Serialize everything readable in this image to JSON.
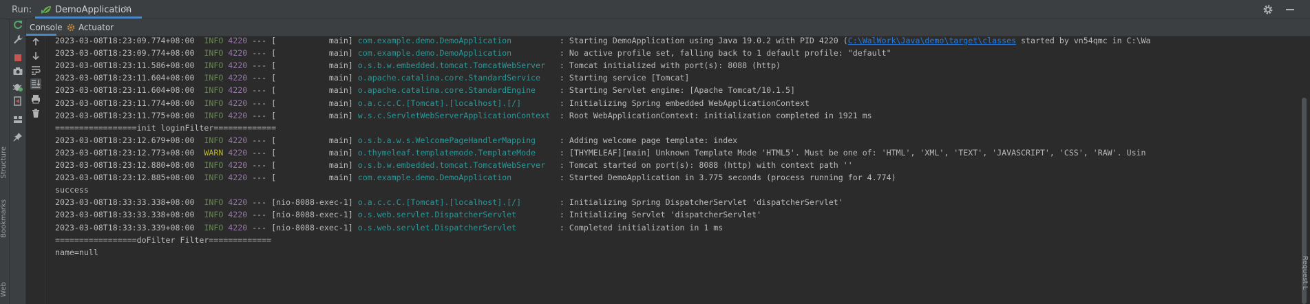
{
  "run_bar": {
    "label": "Run:",
    "tab_label": "DemoApplication",
    "tab_icon": "spring-boot-run-icon",
    "right_icons": [
      "gear-icon",
      "minimize-icon"
    ]
  },
  "sub_tabs": [
    {
      "label": "Console",
      "active": true
    },
    {
      "label": "Actuator",
      "active": false
    }
  ],
  "left_strip_labels": [
    "Structure",
    "Bookmarks",
    "Web"
  ],
  "right_strip_label": "Request L",
  "run_toolbar": [
    "rerun-icon",
    "wrench-icon",
    "stop-icon",
    "camera-icon",
    "debug-icon",
    "exit-icon",
    "layout-icon",
    "pin-icon"
  ],
  "console_toolbar": [
    "arrow-up-icon",
    "arrow-down-icon",
    "soft-wrap-icon",
    "scroll-to-end-icon",
    "print-icon",
    "trash-icon"
  ],
  "colors": {
    "info": "#6a8759",
    "warn": "#bbb529",
    "pid": "#9876aa",
    "logger": "#299999",
    "link": "#287bde",
    "accent": "#4a88c7"
  },
  "log_lines": [
    {
      "ts": "2023-03-08T18:23:09.774+08:00",
      "level": "INFO",
      "pid": "4220",
      "thread": "--- [           main]",
      "logger": "com.example.demo.DemoApplication",
      "msg_before": "Starting DemoApplication using Java 19.0.2 with PID 4220 (",
      "link": "C:\\WalWork\\Java\\demo\\target\\classes",
      "msg_after": " started by vn54qmc in C:\\Wa"
    },
    {
      "ts": "2023-03-08T18:23:09.774+08:00",
      "level": "INFO",
      "pid": "4220",
      "thread": "--- [           main]",
      "logger": "com.example.demo.DemoApplication",
      "msg_before": "No active profile set, falling back to 1 default profile: \"default\"",
      "link": "",
      "msg_after": ""
    },
    {
      "ts": "2023-03-08T18:23:11.586+08:00",
      "level": "INFO",
      "pid": "4220",
      "thread": "--- [           main]",
      "logger": "o.s.b.w.embedded.tomcat.TomcatWebServer",
      "msg_before": "Tomcat initialized with port(s): 8088 (http)",
      "link": "",
      "msg_after": ""
    },
    {
      "ts": "2023-03-08T18:23:11.604+08:00",
      "level": "INFO",
      "pid": "4220",
      "thread": "--- [           main]",
      "logger": "o.apache.catalina.core.StandardService",
      "msg_before": "Starting service [Tomcat]",
      "link": "",
      "msg_after": ""
    },
    {
      "ts": "2023-03-08T18:23:11.604+08:00",
      "level": "INFO",
      "pid": "4220",
      "thread": "--- [           main]",
      "logger": "o.apache.catalina.core.StandardEngine",
      "msg_before": "Starting Servlet engine: [Apache Tomcat/10.1.5]",
      "link": "",
      "msg_after": ""
    },
    {
      "ts": "2023-03-08T18:23:11.774+08:00",
      "level": "INFO",
      "pid": "4220",
      "thread": "--- [           main]",
      "logger": "o.a.c.c.C.[Tomcat].[localhost].[/]",
      "msg_before": "Initializing Spring embedded WebApplicationContext",
      "link": "",
      "msg_after": ""
    },
    {
      "ts": "2023-03-08T18:23:11.775+08:00",
      "level": "INFO",
      "pid": "4220",
      "thread": "--- [           main]",
      "logger": "w.s.c.ServletWebServerApplicationContext",
      "msg_before": "Root WebApplicationContext: initialization completed in 1921 ms",
      "link": "",
      "msg_after": ""
    },
    {
      "plain": "=================init loginFilter============="
    },
    {
      "ts": "2023-03-08T18:23:12.679+08:00",
      "level": "INFO",
      "pid": "4220",
      "thread": "--- [           main]",
      "logger": "o.s.b.a.w.s.WelcomePageHandlerMapping",
      "msg_before": "Adding welcome page template: index",
      "link": "",
      "msg_after": ""
    },
    {
      "ts": "2023-03-08T18:23:12.773+08:00",
      "level": "WARN",
      "pid": "4220",
      "thread": "--- [           main]",
      "logger": "o.thymeleaf.templatemode.TemplateMode",
      "msg_before": "[THYMELEAF][main] Unknown Template Mode 'HTML5'. Must be one of: 'HTML', 'XML', 'TEXT', 'JAVASCRIPT', 'CSS', 'RAW'. Usin",
      "link": "",
      "msg_after": ""
    },
    {
      "ts": "2023-03-08T18:23:12.880+08:00",
      "level": "INFO",
      "pid": "4220",
      "thread": "--- [           main]",
      "logger": "o.s.b.w.embedded.tomcat.TomcatWebServer",
      "msg_before": "Tomcat started on port(s): 8088 (http) with context path ''",
      "link": "",
      "msg_after": ""
    },
    {
      "ts": "2023-03-08T18:23:12.885+08:00",
      "level": "INFO",
      "pid": "4220",
      "thread": "--- [           main]",
      "logger": "com.example.demo.DemoApplication",
      "msg_before": "Started DemoApplication in 3.775 seconds (process running for 4.774)",
      "link": "",
      "msg_after": ""
    },
    {
      "plain": "success"
    },
    {
      "ts": "2023-03-08T18:33:33.338+08:00",
      "level": "INFO",
      "pid": "4220",
      "thread": "--- [nio-8088-exec-1]",
      "logger": "o.a.c.c.C.[Tomcat].[localhost].[/]",
      "msg_before": "Initializing Spring DispatcherServlet 'dispatcherServlet'",
      "link": "",
      "msg_after": ""
    },
    {
      "ts": "2023-03-08T18:33:33.338+08:00",
      "level": "INFO",
      "pid": "4220",
      "thread": "--- [nio-8088-exec-1]",
      "logger": "o.s.web.servlet.DispatcherServlet",
      "msg_before": "Initializing Servlet 'dispatcherServlet'",
      "link": "",
      "msg_after": ""
    },
    {
      "ts": "2023-03-08T18:33:33.339+08:00",
      "level": "INFO",
      "pid": "4220",
      "thread": "--- [nio-8088-exec-1]",
      "logger": "o.s.web.servlet.DispatcherServlet",
      "msg_before": "Completed initialization in 1 ms",
      "link": "",
      "msg_after": ""
    },
    {
      "plain": "=================doFilter Filter============="
    },
    {
      "plain": "name=null"
    }
  ]
}
